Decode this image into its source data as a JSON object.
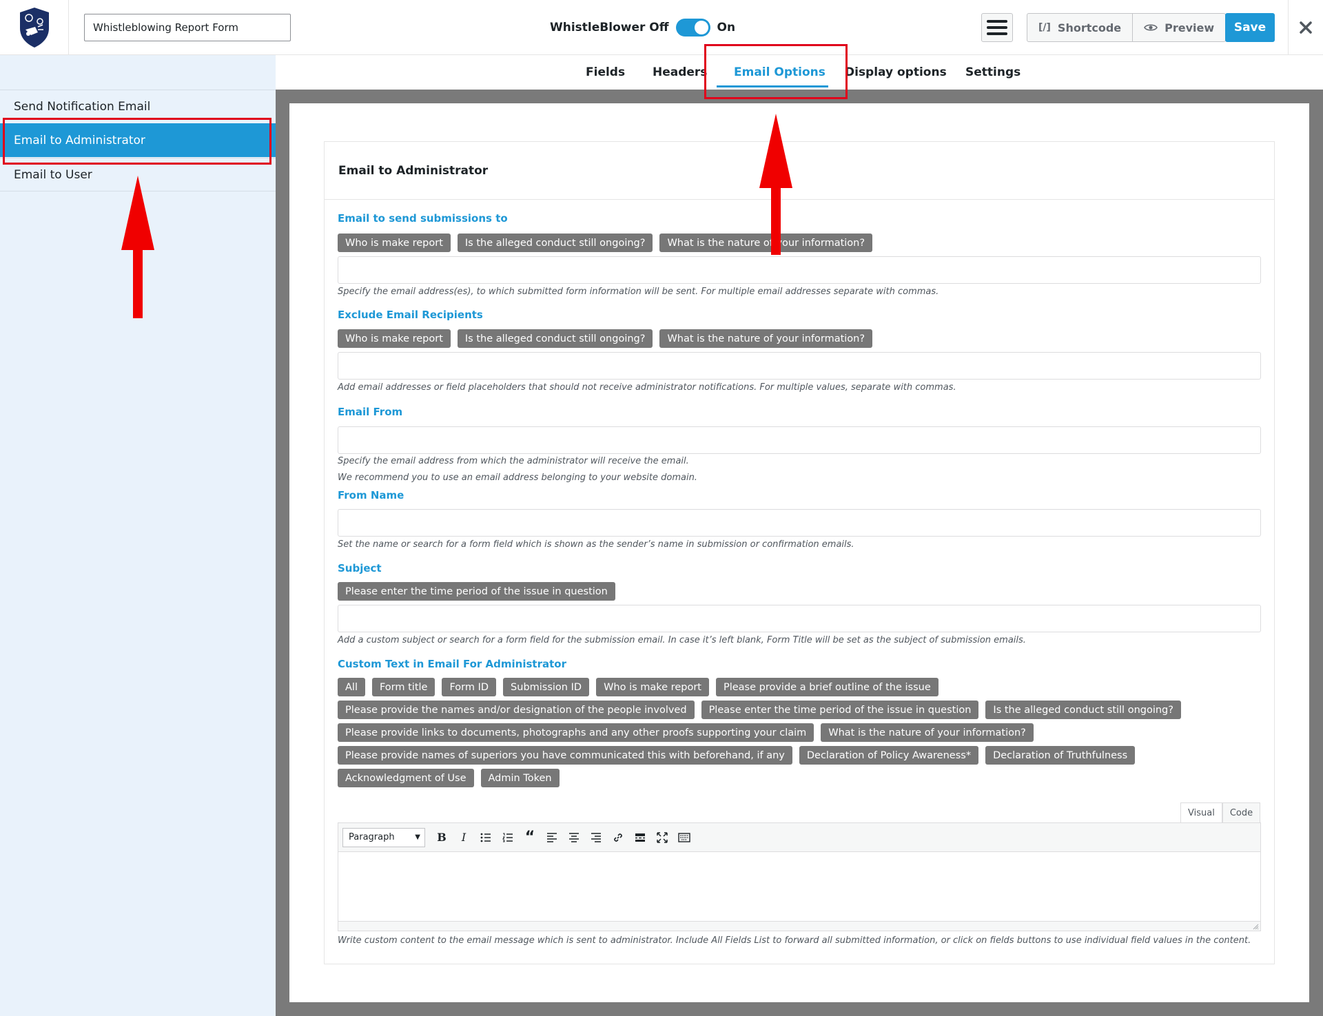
{
  "topbar": {
    "form_title_value": "Whistleblowing Report Form",
    "toggle_off_label": "WhistleBlower Off",
    "toggle_on_label": "On",
    "shortcode_icon": "[/]",
    "shortcode_label": "Shortcode",
    "preview_label": "Preview",
    "save_label": "Save"
  },
  "sidebar": {
    "items": [
      {
        "label": "Send Notification Email"
      },
      {
        "label": "Email to Administrator"
      },
      {
        "label": "Email to User"
      }
    ]
  },
  "tabs": [
    {
      "label": "Fields"
    },
    {
      "label": "Headers"
    },
    {
      "label": "Email Options"
    },
    {
      "label": "Display options"
    },
    {
      "label": "Settings"
    }
  ],
  "panel": {
    "title": "Email to Administrator",
    "sections": {
      "send_to": {
        "label": "Email to send submissions to",
        "chips": [
          "Who is make report",
          "Is the alleged conduct still ongoing?",
          "What is the nature of your information?"
        ],
        "hint": "Specify the email address(es), to which submitted form information will be sent. For multiple email addresses separate with commas."
      },
      "exclude": {
        "label": "Exclude Email Recipients",
        "chips": [
          "Who is make report",
          "Is the alleged conduct still ongoing?",
          "What is the nature of your information?"
        ],
        "hint": "Add email addresses or field placeholders that should not receive administrator notifications. For multiple values, separate with commas."
      },
      "from": {
        "label": "Email From",
        "hint1": "Specify the email address from which the administrator will receive the email.",
        "hint2": "We recommend you to use an email address belonging to your website domain."
      },
      "from_name": {
        "label": "From Name",
        "hint": "Set the name or search for a form field which is shown as the sender’s name in submission or confirmation emails."
      },
      "subject": {
        "label": "Subject",
        "chips": [
          "Please enter the time period of the issue in question"
        ],
        "hint": "Add a custom subject or search for a form field for the submission email. In case it’s left blank, Form Title will be set as the subject of submission emails."
      },
      "custom_text": {
        "label": "Custom Text in Email For Administrator",
        "chips": [
          "All",
          "Form title",
          "Form ID",
          "Submission ID",
          "Who is make report",
          "Please provide a brief outline of the issue",
          "Please provide the names and/or designation of the people involved",
          "Please enter the time period of the issue in question",
          "Is the alleged conduct still ongoing?",
          "Please provide links to documents, photographs and any other proofs supporting your claim",
          "What is the nature of your information?",
          "Please provide names of superiors you have communicated this with beforehand, if any",
          "Declaration of Policy Awareness*",
          "Declaration of Truthfulness",
          "Acknowledgment of Use",
          "Admin Token"
        ],
        "editor_tab_visual": "Visual",
        "editor_tab_code": "Code",
        "paragraph_select": "Paragraph",
        "hint": "Write custom content to the email message which is sent to administrator. Include All Fields List to forward all submitted information, or click on fields buttons to use individual field values in the content."
      }
    }
  },
  "colors": {
    "accent": "#1e98d6",
    "chip_bg": "#777777",
    "annotation_red": "#e0001b"
  },
  "icons": [
    "shield-logo-icon",
    "hamburger-icon",
    "eye-icon",
    "close-icon",
    "bold-icon",
    "italic-icon",
    "bullet-list-icon",
    "numbered-list-icon",
    "blockquote-icon",
    "align-left-icon",
    "align-center-icon",
    "align-right-icon",
    "link-icon",
    "read-more-icon",
    "fullscreen-icon",
    "toolbar-toggle-icon"
  ]
}
